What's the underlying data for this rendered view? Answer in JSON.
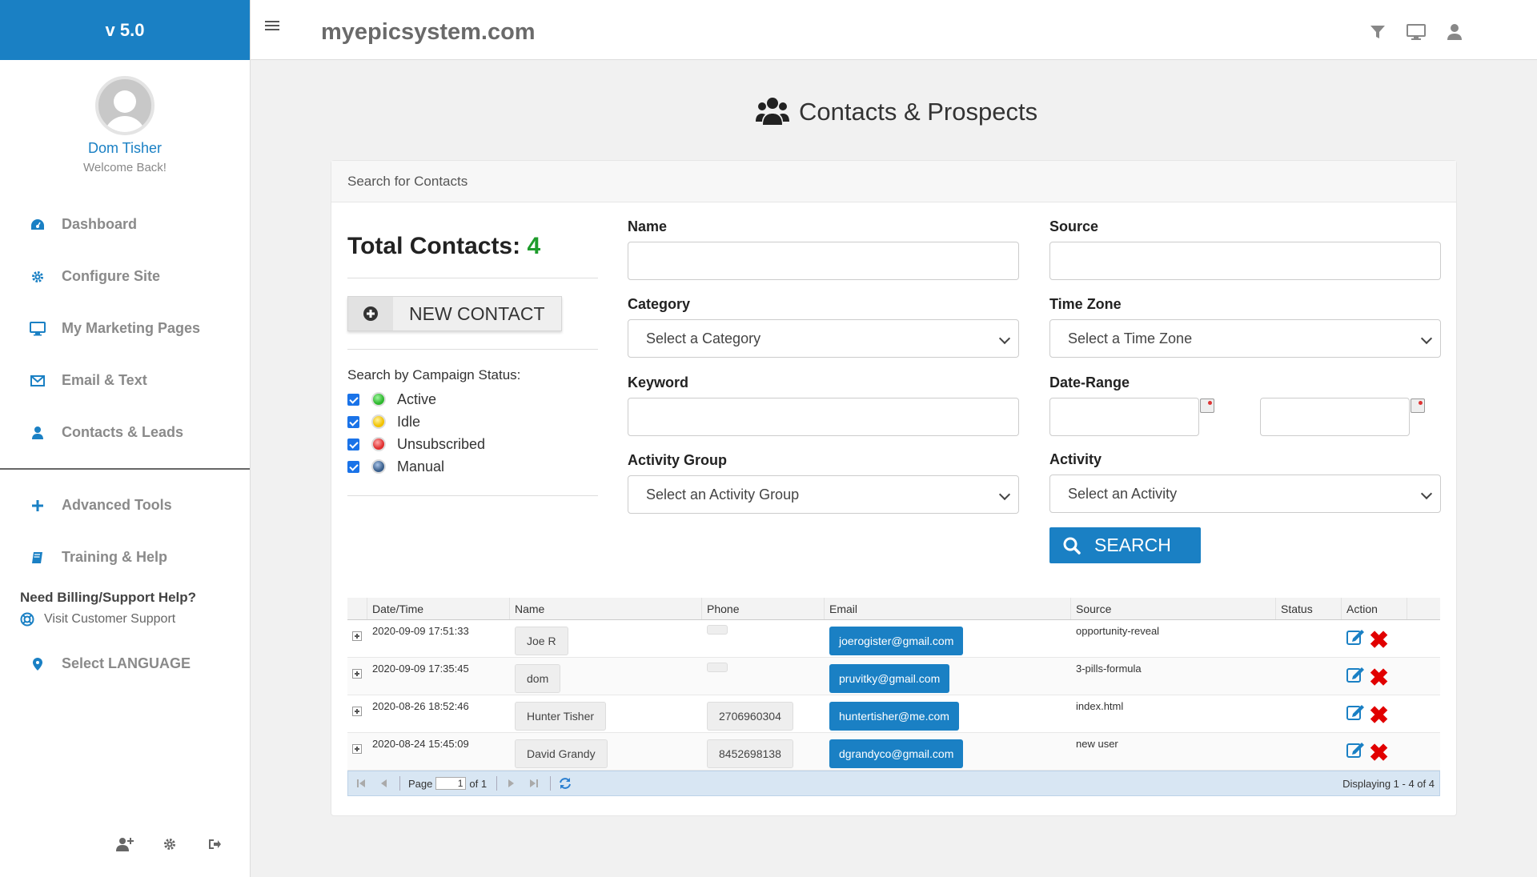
{
  "sidebar": {
    "version": "v 5.0",
    "user_name": "Dom Tisher",
    "welcome": "Welcome Back!",
    "items": [
      {
        "label": "Dashboard",
        "icon": "dashboard-icon"
      },
      {
        "label": "Configure Site",
        "icon": "gear-icon"
      },
      {
        "label": "My Marketing Pages",
        "icon": "desktop-icon"
      },
      {
        "label": "Email & Text",
        "icon": "envelope-icon"
      },
      {
        "label": "Contacts & Leads",
        "icon": "user-icon"
      }
    ],
    "items2": [
      {
        "label": "Advanced Tools",
        "icon": "plus-icon"
      },
      {
        "label": "Training & Help",
        "icon": "book-icon"
      }
    ],
    "billing_title": "Need Billing/Support Help?",
    "support_link": "Visit Customer Support",
    "language": "Select LANGUAGE"
  },
  "header": {
    "site": "myepicsystem.com"
  },
  "page": {
    "title": "Contacts & Prospects",
    "panel_title": "Search for Contacts"
  },
  "left": {
    "total_label": "Total Contacts:",
    "total_value": "4",
    "new_contact": "NEW CONTACT",
    "campaign_title": "Search by Campaign Status:",
    "statuses": [
      {
        "label": "Active",
        "color": "#2eb82e"
      },
      {
        "label": "Idle",
        "color": "#f2c200"
      },
      {
        "label": "Unsubscribed",
        "color": "#e03030"
      },
      {
        "label": "Manual",
        "color": "#3a5f8c"
      }
    ]
  },
  "form": {
    "name_label": "Name",
    "source_label": "Source",
    "category_label": "Category",
    "category_value": "Select a Category",
    "timezone_label": "Time Zone",
    "timezone_value": "Select a Time Zone",
    "keyword_label": "Keyword",
    "daterange_label": "Date-Range",
    "activity_group_label": "Activity Group",
    "activity_group_value": "Select an Activity Group",
    "activity_label": "Activity",
    "activity_value": "Select an Activity",
    "search_button": "SEARCH"
  },
  "grid": {
    "columns": [
      "Date/Time",
      "Name",
      "Phone",
      "Email",
      "Source",
      "Status",
      "Action"
    ],
    "rows": [
      {
        "datetime": "2020-09-09 17:51:33",
        "name": "Joe R",
        "phone": "",
        "email": "joerogister@gmail.com",
        "source": "opportunity-reveal",
        "status": ""
      },
      {
        "datetime": "2020-09-09 17:35:45",
        "name": "dom",
        "phone": "",
        "email": "pruvitky@gmail.com",
        "source": "3-pills-formula",
        "status": ""
      },
      {
        "datetime": "2020-08-26 18:52:46",
        "name": "Hunter Tisher",
        "phone": "2706960304",
        "email": "huntertisher@me.com",
        "source": "index.html",
        "status": ""
      },
      {
        "datetime": "2020-08-24 15:45:09",
        "name": "David Grandy",
        "phone": "8452698138",
        "email": "dgrandyco@gmail.com",
        "source": "new user",
        "status": ""
      }
    ],
    "pager": {
      "page_label": "Page",
      "page_value": "1",
      "of_label": "of 1",
      "displaying": "Displaying 1 - 4 of 4"
    }
  }
}
